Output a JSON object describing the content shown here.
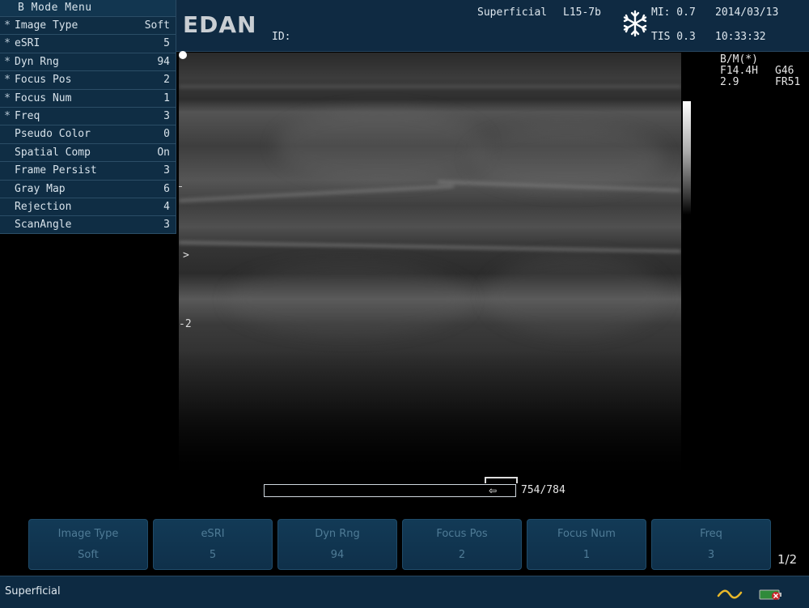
{
  "menu": {
    "title": "B Mode Menu",
    "items": [
      {
        "star": "*",
        "label": "Image Type",
        "value": "Soft"
      },
      {
        "star": "*",
        "label": "eSRI",
        "value": "5"
      },
      {
        "star": "*",
        "label": "Dyn Rng",
        "value": "94"
      },
      {
        "star": "*",
        "label": "Focus Pos",
        "value": "2"
      },
      {
        "star": "*",
        "label": "Focus Num",
        "value": "1"
      },
      {
        "star": "*",
        "label": "Freq",
        "value": "3"
      },
      {
        "star": "",
        "label": "Pseudo Color",
        "value": "0"
      },
      {
        "star": "",
        "label": "Spatial Comp",
        "value": "On"
      },
      {
        "star": "",
        "label": "Frame Persist",
        "value": "3"
      },
      {
        "star": "",
        "label": "Gray Map",
        "value": "6"
      },
      {
        "star": "",
        "label": "Rejection",
        "value": "4"
      },
      {
        "star": "",
        "label": "ScanAngle",
        "value": "3"
      }
    ]
  },
  "header": {
    "logo": "EDAN",
    "id_label": "ID:",
    "preset": "Superficial",
    "probe": "L15-7b",
    "mi": "MI: 0.7",
    "tis": "TIS 0.3",
    "date": "2014/03/13",
    "time": "10:33:32"
  },
  "image": {
    "focus_marker": ">",
    "depth_label": "-2"
  },
  "params": [
    {
      "a": "B/M(*)",
      "b": ""
    },
    {
      "a": "F14.4H",
      "b": "G46"
    },
    {
      "a": "2.9",
      "b": "FR51"
    }
  ],
  "cine": {
    "counter": "754/784",
    "marker": "⇦",
    "progress": 0.96
  },
  "softkeys": [
    {
      "label": "Image Type",
      "value": "Soft"
    },
    {
      "label": "eSRI",
      "value": "5"
    },
    {
      "label": "Dyn Rng",
      "value": "94"
    },
    {
      "label": "Focus Pos",
      "value": "2"
    },
    {
      "label": "Focus Num",
      "value": "1"
    },
    {
      "label": "Freq",
      "value": "3"
    }
  ],
  "page_indicator": "1/2",
  "status": {
    "preset": "Superficial"
  },
  "icons": {
    "freeze": "snowflake-icon",
    "wave": "wave-icon",
    "battery": "battery-icon"
  },
  "colors": {
    "panel": "#0f2d44",
    "header": "#0f2a42",
    "softkey_text": "#4f7b96"
  }
}
